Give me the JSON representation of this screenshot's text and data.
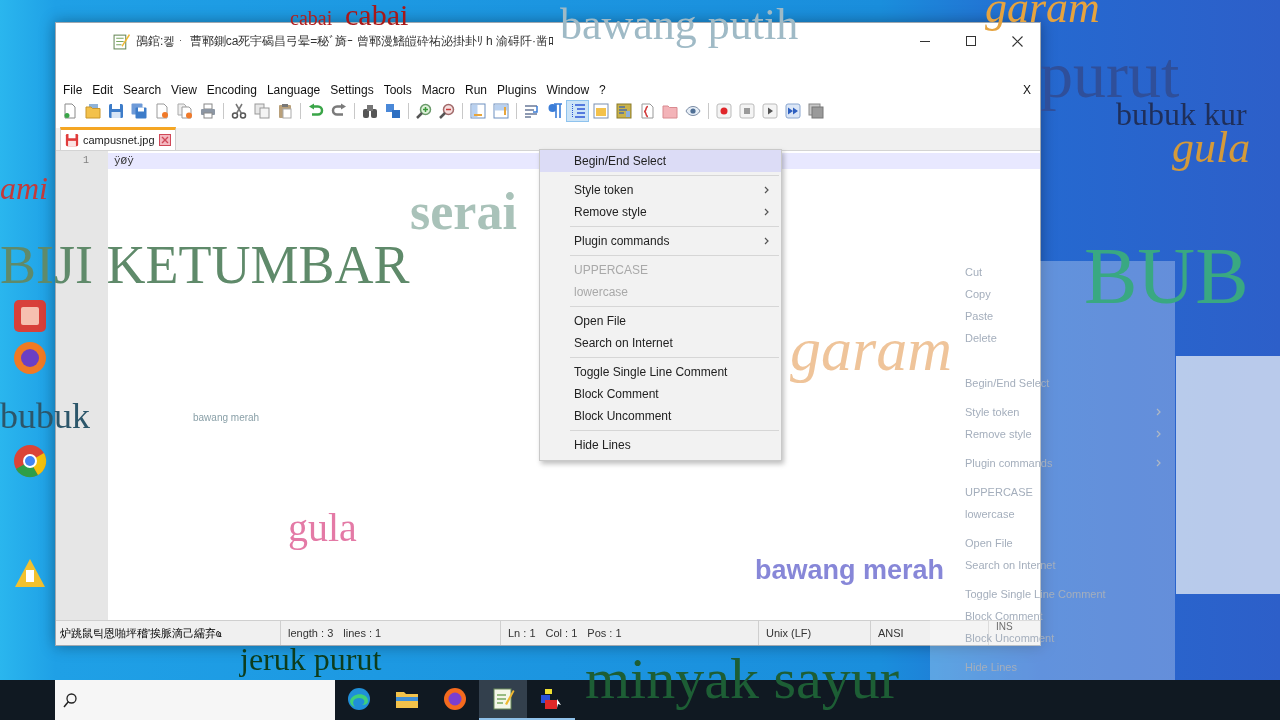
{
  "window": {
    "title": "䳂錧:켛ᆞ 曹鄆鍘ca死宇碣昌弓晕=秘ﾞ旖ｰ 曾鄆漫鰭皚砕祐泌掛卦ﾘ h 渝碍阡·凿ﾛ",
    "menu": [
      "File",
      "Edit",
      "Search",
      "View",
      "Encoding",
      "Language",
      "Settings",
      "Tools",
      "Macro",
      "Run",
      "Plugins",
      "Window",
      "?"
    ],
    "menu_close": "X",
    "toolbar": [
      {
        "kind": "new",
        "selected": false
      },
      {
        "kind": "open",
        "selected": false
      },
      {
        "kind": "save",
        "selected": false
      },
      {
        "kind": "saveall",
        "selected": false
      },
      {
        "kind": "close",
        "selected": false
      },
      {
        "kind": "closeall",
        "selected": false
      },
      {
        "kind": "print",
        "selected": false
      },
      {
        "kind": "separator"
      },
      {
        "kind": "cut",
        "selected": false
      },
      {
        "kind": "copy",
        "selected": false
      },
      {
        "kind": "paste",
        "selected": false
      },
      {
        "kind": "separator"
      },
      {
        "kind": "undo",
        "selected": false
      },
      {
        "kind": "redo",
        "selected": false
      },
      {
        "kind": "separator"
      },
      {
        "kind": "find",
        "selected": false
      },
      {
        "kind": "replace",
        "selected": false
      },
      {
        "kind": "separator"
      },
      {
        "kind": "zoomin",
        "selected": false
      },
      {
        "kind": "zoomout",
        "selected": false
      },
      {
        "kind": "separator"
      },
      {
        "kind": "syncv",
        "selected": false
      },
      {
        "kind": "synch",
        "selected": false
      },
      {
        "kind": "separator"
      },
      {
        "kind": "wrap",
        "selected": false
      },
      {
        "kind": "allchars",
        "selected": false
      },
      {
        "kind": "indent",
        "selected": true
      },
      {
        "kind": "udl",
        "selected": false
      },
      {
        "kind": "docmap",
        "selected": false
      },
      {
        "kind": "funclist",
        "selected": false
      },
      {
        "kind": "workspace",
        "selected": false
      },
      {
        "kind": "monitor",
        "selected": false
      },
      {
        "kind": "separator"
      },
      {
        "kind": "record",
        "selected": false
      },
      {
        "kind": "stop",
        "selected": false
      },
      {
        "kind": "play",
        "selected": false
      },
      {
        "kind": "playmulti",
        "selected": false
      },
      {
        "kind": "savemacro",
        "selected": false
      }
    ],
    "tabs": [
      {
        "label": "campusnet.jpg",
        "selected": true,
        "modified": true
      }
    ],
    "editor": {
      "lines": [
        {
          "number": "1",
          "text": "ÿØÿ",
          "current": true
        }
      ]
    },
    "status_bar": {
      "message": "炉跳鼠틱恩啪坪稽'挨脈滴己繻弃ҩ",
      "length": "length : 3",
      "lines": "lines : 1",
      "line": "Ln : 1",
      "column": "Col : 1",
      "position": "Pos : 1",
      "eol": "Unix (LF)",
      "encoding": "ANSI",
      "mode": "INS"
    }
  },
  "context_menu": [
    {
      "kind": "item",
      "label": "Begin/End Select",
      "selected": true,
      "disabled": false,
      "submenu": false
    },
    {
      "kind": "separator"
    },
    {
      "kind": "item",
      "label": "Style token",
      "selected": false,
      "disabled": false,
      "submenu": true
    },
    {
      "kind": "item",
      "label": "Remove style",
      "selected": false,
      "disabled": false,
      "submenu": true
    },
    {
      "kind": "separator"
    },
    {
      "kind": "item",
      "label": "Plugin commands",
      "selected": false,
      "disabled": false,
      "submenu": true
    },
    {
      "kind": "separator"
    },
    {
      "kind": "item",
      "label": "UPPERCASE",
      "selected": false,
      "disabled": true,
      "submenu": false
    },
    {
      "kind": "item",
      "label": "lowercase",
      "selected": false,
      "disabled": true,
      "submenu": false
    },
    {
      "kind": "separator"
    },
    {
      "kind": "item",
      "label": "Open File",
      "selected": false,
      "disabled": false,
      "submenu": false
    },
    {
      "kind": "item",
      "label": "Search on Internet",
      "selected": false,
      "disabled": false,
      "submenu": false
    },
    {
      "kind": "separator"
    },
    {
      "kind": "item",
      "label": "Toggle Single Line Comment",
      "selected": false,
      "disabled": false,
      "submenu": false
    },
    {
      "kind": "item",
      "label": "Block Comment",
      "selected": false,
      "disabled": false,
      "submenu": false
    },
    {
      "kind": "item",
      "label": "Block Uncomment",
      "selected": false,
      "disabled": false,
      "submenu": false
    },
    {
      "kind": "separator"
    },
    {
      "kind": "item",
      "label": "Hide Lines",
      "selected": false,
      "disabled": false,
      "submenu": false
    }
  ],
  "ghost_menu": [
    {
      "kind": "item",
      "label": "Cut",
      "submenu": false
    },
    {
      "kind": "item",
      "label": "Copy",
      "submenu": false
    },
    {
      "kind": "item",
      "label": "Paste",
      "submenu": false
    },
    {
      "kind": "item",
      "label": "Delete",
      "submenu": false
    },
    {
      "kind": "separator"
    },
    {
      "kind": "item",
      "label": "Begin/End Select",
      "submenu": false
    },
    {
      "kind": "separator"
    },
    {
      "kind": "item",
      "label": "Style token",
      "submenu": true
    },
    {
      "kind": "item",
      "label": "Remove style",
      "submenu": true
    },
    {
      "kind": "separator"
    },
    {
      "kind": "item",
      "label": "Plugin commands",
      "submenu": true
    },
    {
      "kind": "separator"
    },
    {
      "kind": "item",
      "label": "UPPERCASE",
      "submenu": false
    },
    {
      "kind": "item",
      "label": "lowercase",
      "submenu": false
    },
    {
      "kind": "separator"
    },
    {
      "kind": "item",
      "label": "Open File",
      "submenu": false
    },
    {
      "kind": "item",
      "label": "Search on Internet",
      "submenu": false
    },
    {
      "kind": "separator"
    },
    {
      "kind": "item",
      "label": "Toggle Single Line Comment",
      "submenu": false
    },
    {
      "kind": "item",
      "label": "Block Comment",
      "submenu": false
    },
    {
      "kind": "item",
      "label": "Block Uncomment",
      "submenu": false
    },
    {
      "kind": "separator"
    },
    {
      "kind": "item",
      "label": "Hide Lines",
      "submenu": false
    }
  ],
  "overlay_words": [
    "cabai",
    "cabai",
    "bawang putih",
    "garam",
    "purut",
    "bubuk kur",
    "gula",
    "ami",
    "serai",
    "BIJI KETUMBAR",
    "BUB",
    "garam",
    "bubuk",
    "bawang merah",
    "gula",
    "bawang merah",
    "jeruk purut",
    "minyak sayur"
  ],
  "taskbar": {
    "apps": [
      {
        "kind": "swirl",
        "selected": false,
        "running": false
      },
      {
        "kind": "folder",
        "selected": false,
        "running": false
      },
      {
        "kind": "fox",
        "selected": false,
        "running": false
      },
      {
        "kind": "notepad",
        "selected": true,
        "running": true
      },
      {
        "kind": "blocks",
        "selected": false,
        "running": true
      }
    ]
  }
}
